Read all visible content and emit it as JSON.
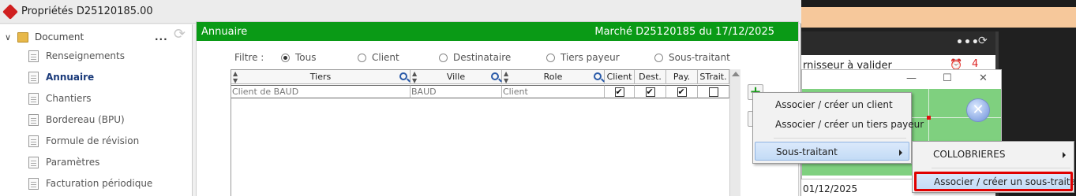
{
  "window": {
    "title": "Propriétés D25120185.00"
  },
  "tree": {
    "root_label": "Document",
    "more_label": "...",
    "items": [
      {
        "label": "Renseignements",
        "selected": false
      },
      {
        "label": "Annuaire",
        "selected": true
      },
      {
        "label": "Chantiers",
        "selected": false
      },
      {
        "label": "Bordereau (BPU)",
        "selected": false
      },
      {
        "label": "Formule de révision",
        "selected": false
      },
      {
        "label": "Paramètres",
        "selected": false
      },
      {
        "label": "Facturation périodique",
        "selected": false
      }
    ]
  },
  "panel": {
    "title": "Annuaire",
    "market": "Marché D25120185 du 17/12/2025",
    "header_color": "#0a9a16"
  },
  "filter": {
    "label": "Filtre :",
    "options": [
      {
        "label": "Tous",
        "selected": true
      },
      {
        "label": "Client",
        "selected": false
      },
      {
        "label": "Destinataire",
        "selected": false
      },
      {
        "label": "Tiers payeur",
        "selected": false
      },
      {
        "label": "Sous-traitant",
        "selected": false
      }
    ]
  },
  "grid": {
    "columns": [
      "Tiers",
      "Ville",
      "Role",
      "Client",
      "Dest.",
      "Pay.",
      "STrait."
    ],
    "rows": [
      {
        "tiers": "Client de BAUD",
        "ville": "BAUD",
        "role": "Client",
        "client": true,
        "dest": true,
        "pay": true,
        "strait": false
      }
    ]
  },
  "context_menu": {
    "items": [
      "Associer / créer un client",
      "Associer / créer un tiers payeur",
      "Sous-traitant"
    ]
  },
  "submenu": {
    "items": [
      "COLLOBRIERES",
      "Associer / créer un sous-traitant"
    ]
  },
  "background": {
    "row_text": "rnisseur à valider",
    "alarm_count": "4",
    "date": "01/12/2025",
    "more_label": "•••",
    "accent_color": "#f6c89b"
  },
  "dialog": {
    "minimize": "—",
    "maximize": "☐",
    "close": "✕"
  }
}
